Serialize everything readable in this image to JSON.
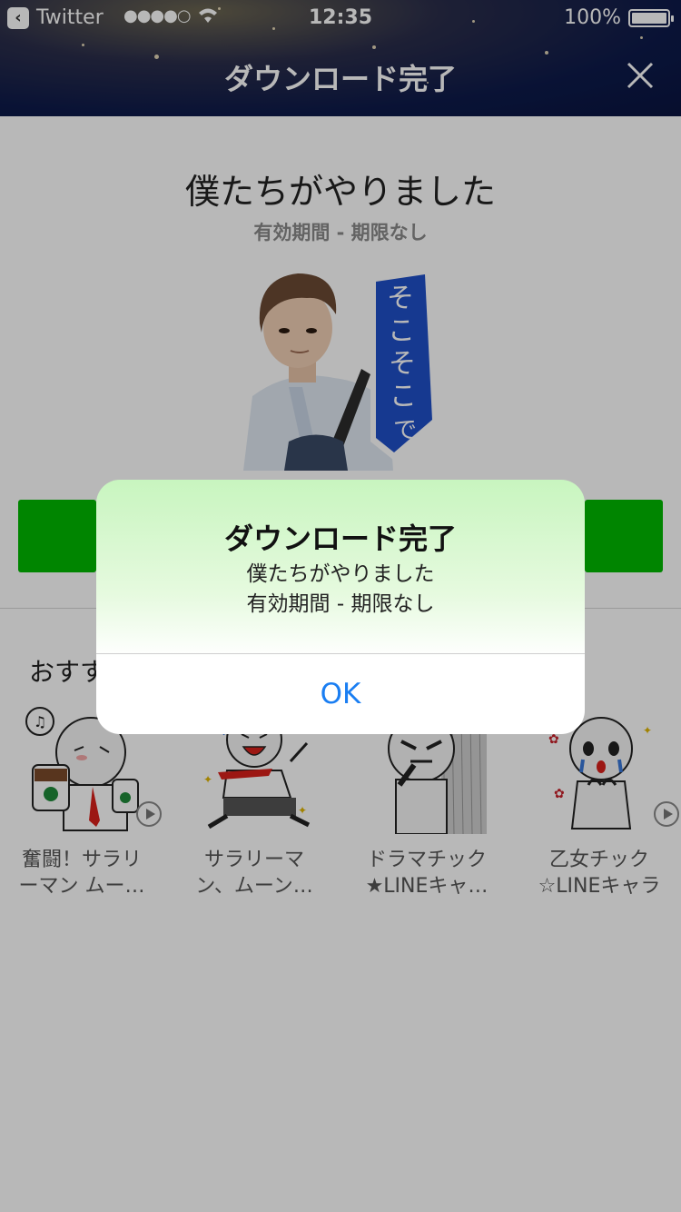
{
  "status_bar": {
    "back_app": "Twitter",
    "signal": "●●●●○",
    "time": "12:35",
    "battery": "100%"
  },
  "nav": {
    "title": "ダウンロード完了"
  },
  "sticker": {
    "title": "僕たちがやりました",
    "validity": "有効期間 - 期限なし",
    "caption": "そこそこでいい"
  },
  "recommend": {
    "heading": "おすすめ",
    "items": [
      {
        "line1": "奮闘！サラリ",
        "line2": "ーマン ムー…"
      },
      {
        "line1": "サラリーマ",
        "line2": "ン、ムーン…"
      },
      {
        "line1": "ドラマチック",
        "line2": "★LINEキャ…"
      },
      {
        "line1": "乙女チック",
        "line2": "☆LINEキャラ"
      }
    ]
  },
  "alert": {
    "title": "ダウンロード完了",
    "message_line1": "僕たちがやりました",
    "message_line2": "有効期間 - 期限なし",
    "ok_label": "OK"
  },
  "colors": {
    "accent_green": "#00b900",
    "ios_blue": "#1a7ef2",
    "header_navy": "#0a1440"
  },
  "icons": [
    "back-arrow-icon",
    "wifi-icon",
    "battery-icon",
    "close-icon",
    "play-icon"
  ]
}
